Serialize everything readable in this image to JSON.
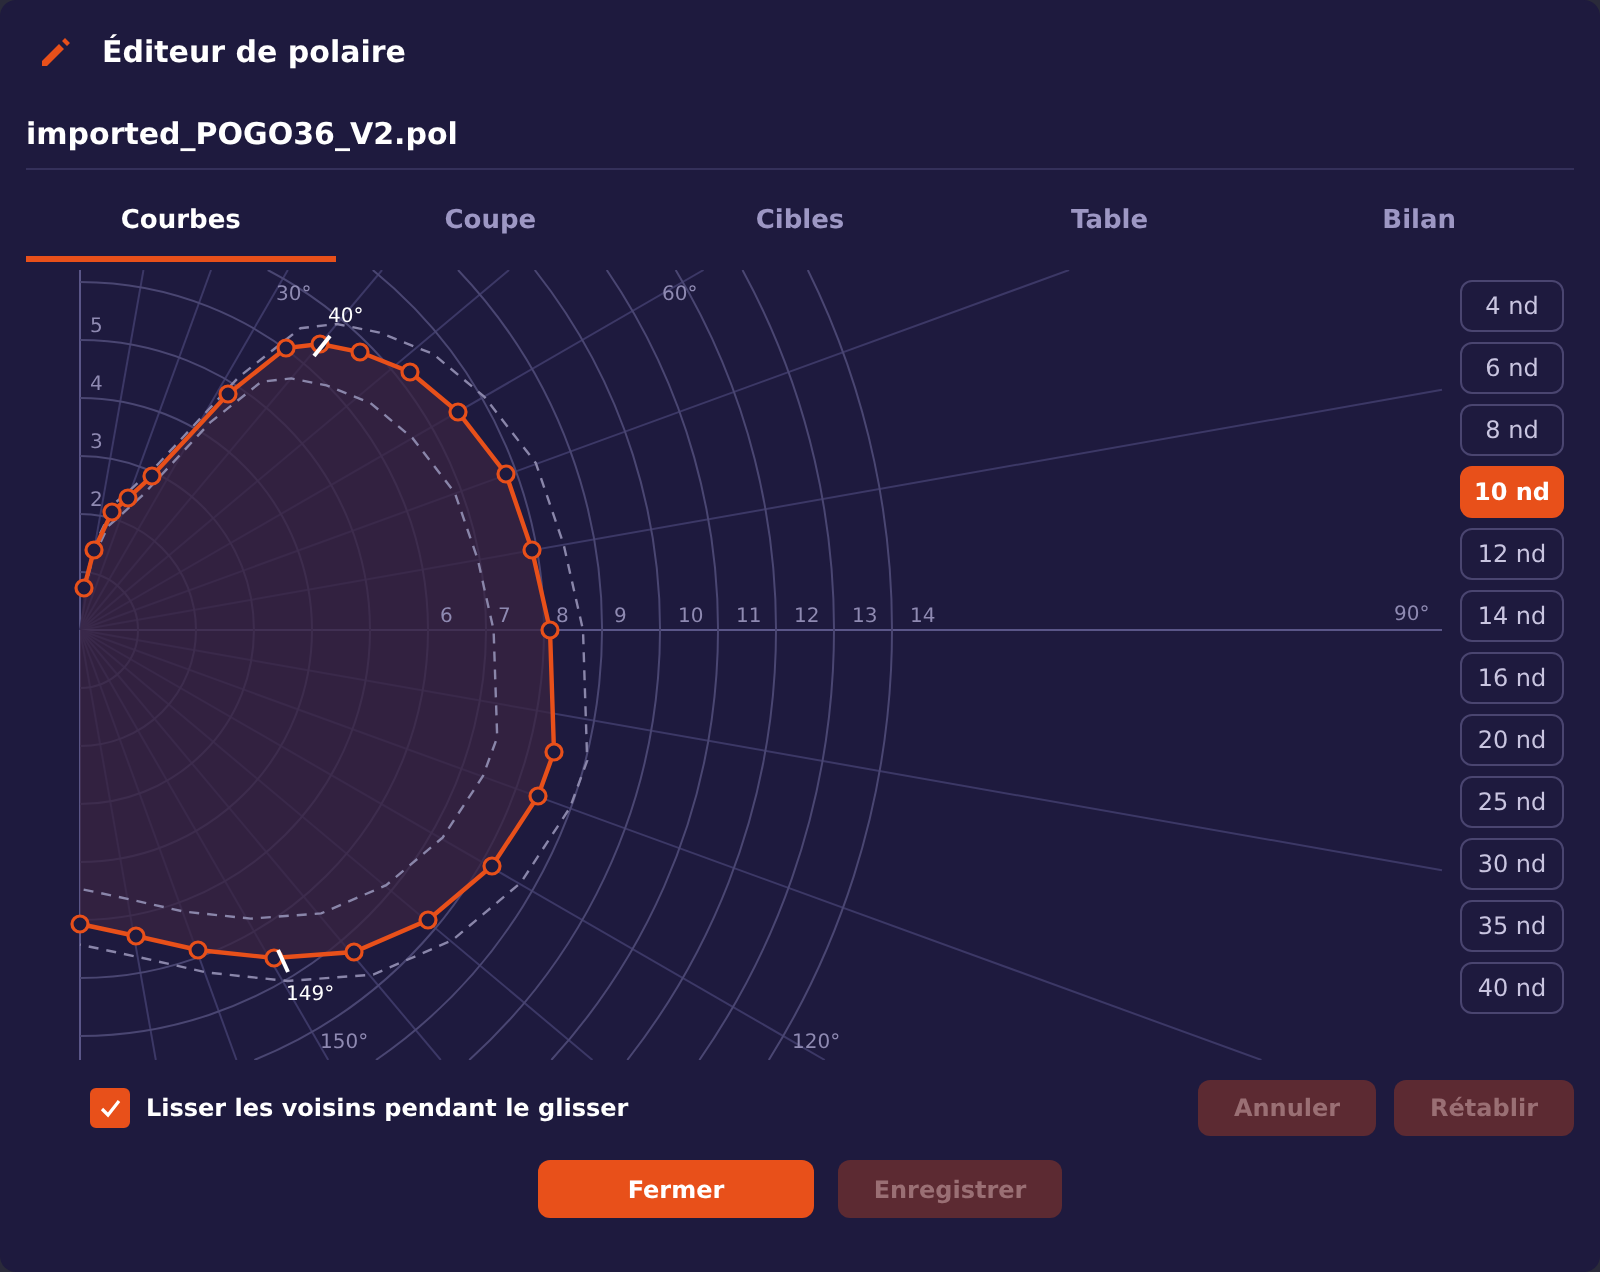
{
  "window": {
    "title": "Éditeur de polaire"
  },
  "file_name": "imported_POGO36_V2.pol",
  "tabs": [
    {
      "label": "Courbes",
      "selected": true
    },
    {
      "label": "Coupe",
      "selected": false
    },
    {
      "label": "Cibles",
      "selected": false
    },
    {
      "label": "Table",
      "selected": false
    },
    {
      "label": "Bilan",
      "selected": false
    }
  ],
  "polar": {
    "speed_labels_vertical": [
      "5",
      "4",
      "3",
      "2"
    ],
    "speed_labels_horizontal": [
      "6",
      "7",
      "8",
      "9",
      "10",
      "11",
      "12",
      "13",
      "14"
    ],
    "angle_labels": [
      "30°",
      "60°",
      "90°",
      "120°",
      "150°"
    ],
    "markers": [
      "40°",
      "149°"
    ]
  },
  "speeds": [
    {
      "label": "4 nd",
      "selected": false
    },
    {
      "label": "6 nd",
      "selected": false
    },
    {
      "label": "8 nd",
      "selected": false
    },
    {
      "label": "10 nd",
      "selected": true
    },
    {
      "label": "12 nd",
      "selected": false
    },
    {
      "label": "14 nd",
      "selected": false
    },
    {
      "label": "16 nd",
      "selected": false
    },
    {
      "label": "20 nd",
      "selected": false
    },
    {
      "label": "25 nd",
      "selected": false
    },
    {
      "label": "30 nd",
      "selected": false
    },
    {
      "label": "35 nd",
      "selected": false
    },
    {
      "label": "40 nd",
      "selected": false
    }
  ],
  "smooth_option": {
    "label": "Lisser les voisins pendant le glisser",
    "checked": true
  },
  "history_buttons": [
    {
      "label": "Annuler",
      "disabled": true
    },
    {
      "label": "Rétablir",
      "disabled": true
    }
  ],
  "footer_buttons": [
    {
      "label": "Fermer",
      "disabled": false
    },
    {
      "label": "Enregistrer",
      "disabled": true
    }
  ]
}
